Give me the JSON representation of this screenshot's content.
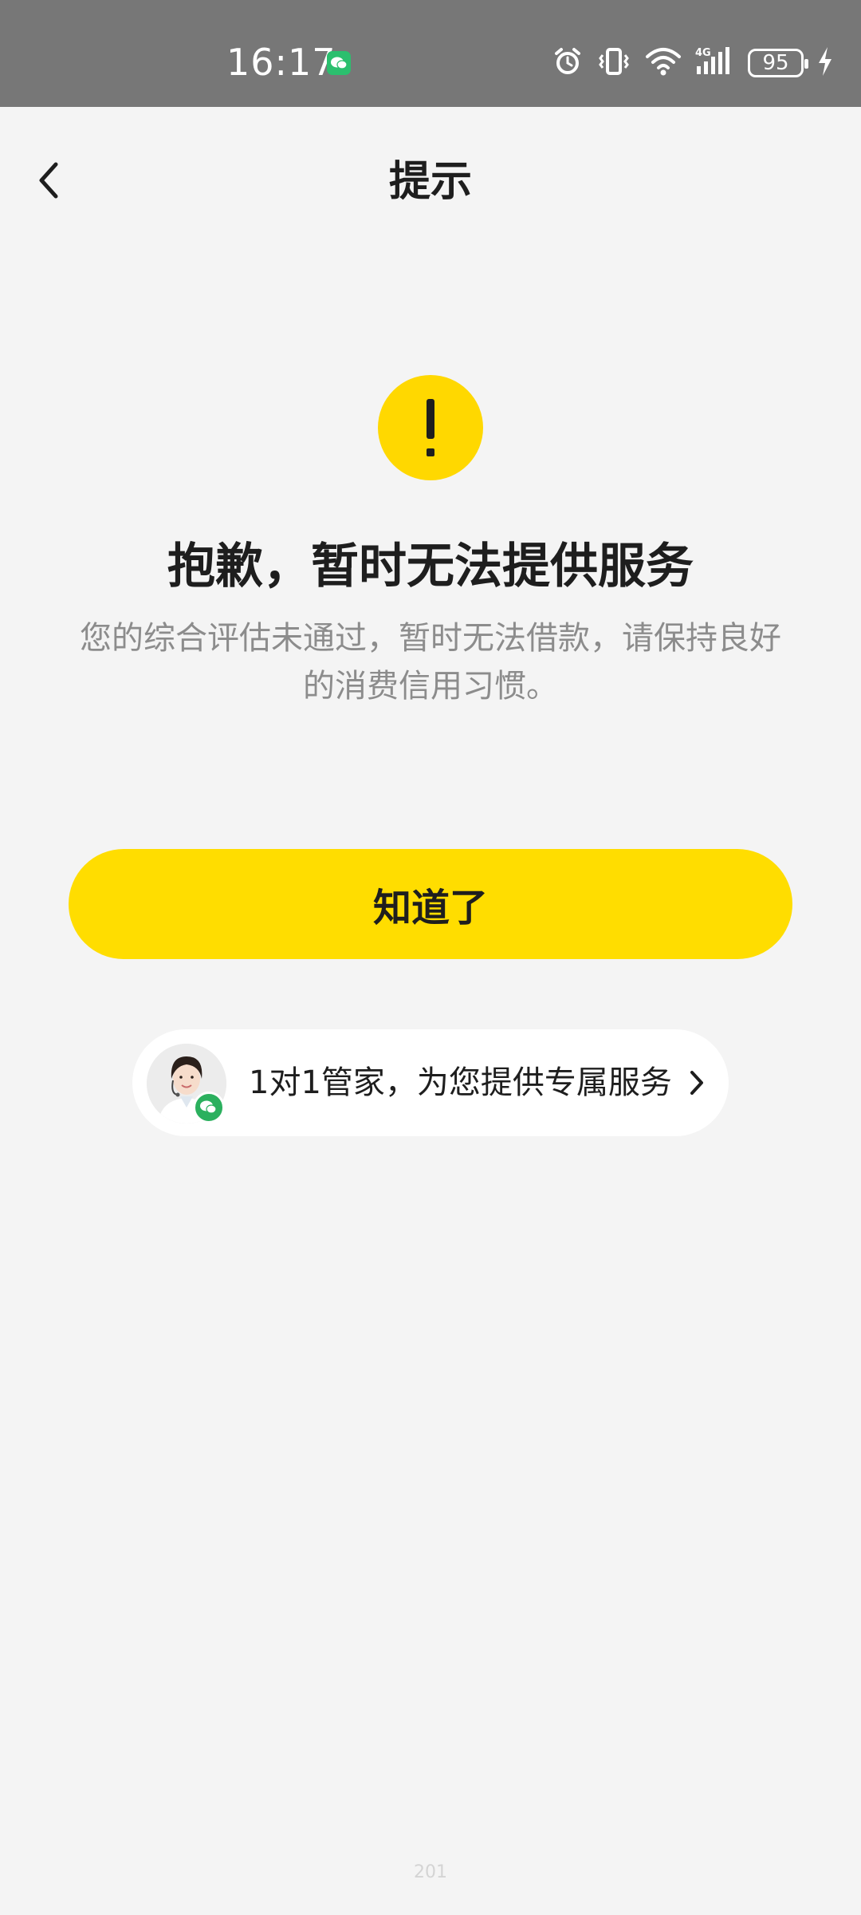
{
  "status_bar": {
    "time": "16:17",
    "battery": "95"
  },
  "header": {
    "title": "提示"
  },
  "alert": {
    "symbol": "!",
    "headline": "抱歉，暂时无法提供服务",
    "description": "您的综合评估未通过，暂时无法借款，请保持良好的消费信用习惯。"
  },
  "actions": {
    "confirm_label": "知道了"
  },
  "service": {
    "label": "1对1管家，为您提供专属服务"
  },
  "footer": {
    "code": "201"
  },
  "colors": {
    "accent": "#ffdd00",
    "status_bar": "#777777",
    "background": "#f4f4f4",
    "wechat_green": "#2bb05e"
  },
  "icons": {
    "back": "chevron-left-icon",
    "alert": "exclamation-icon",
    "service_arrow": "chevron-right-icon",
    "badge": "wechat-icon"
  }
}
